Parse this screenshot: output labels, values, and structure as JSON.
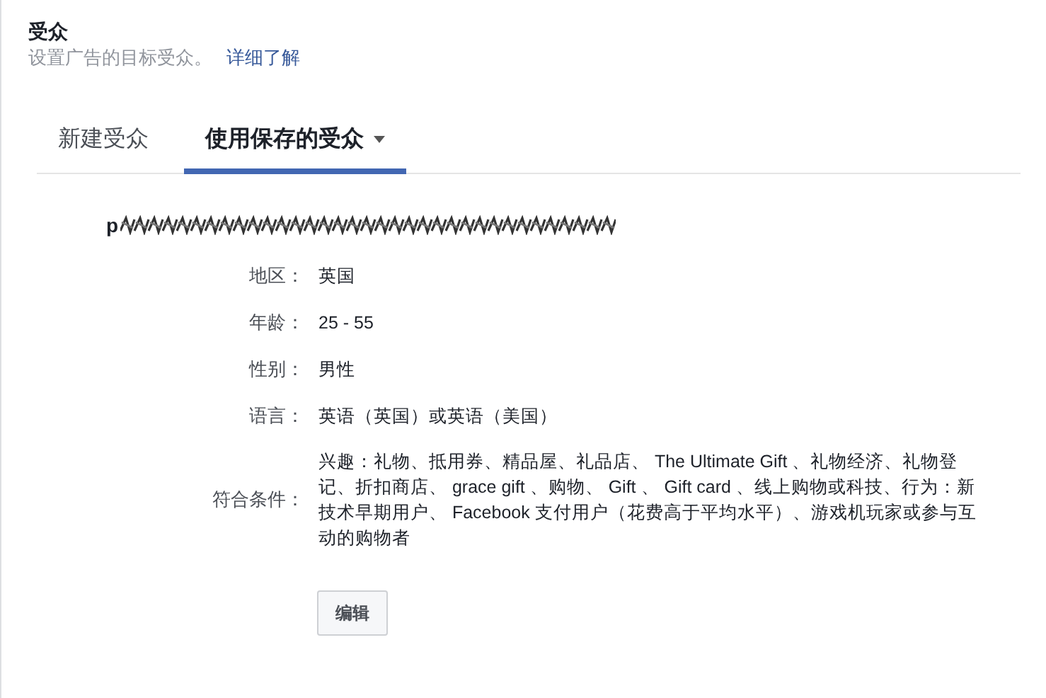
{
  "section": {
    "title": "受众",
    "description": "设置广告的目标受众。",
    "link": "详细了解"
  },
  "tabs": [
    {
      "label": "新建受众",
      "selected": false,
      "dropdown": false
    },
    {
      "label": "使用保存的受众",
      "selected": true,
      "dropdown": true
    }
  ],
  "saved_audience": {
    "name": "p",
    "name_obscured": true
  },
  "details": [
    {
      "label": "地区：",
      "value": "英国"
    },
    {
      "label": "年龄：",
      "value": "25 - 55"
    },
    {
      "label": "性别：",
      "value": "男性"
    },
    {
      "label": "语言：",
      "value": "英语（英国）或英语（美国）"
    },
    {
      "label": "符合条件：",
      "value": "兴趣：礼物、抵用券、精品屋、礼品店、 The Ultimate Gift 、礼物经济、礼物登记、折扣商店、 grace gift 、购物、 Gift 、 Gift card 、线上购物或科技、行为：新技术早期用户、 Facebook 支付用户（花费高于平均水平）、游戏机玩家或参与互动的购物者"
    }
  ],
  "edit_button": "编辑"
}
